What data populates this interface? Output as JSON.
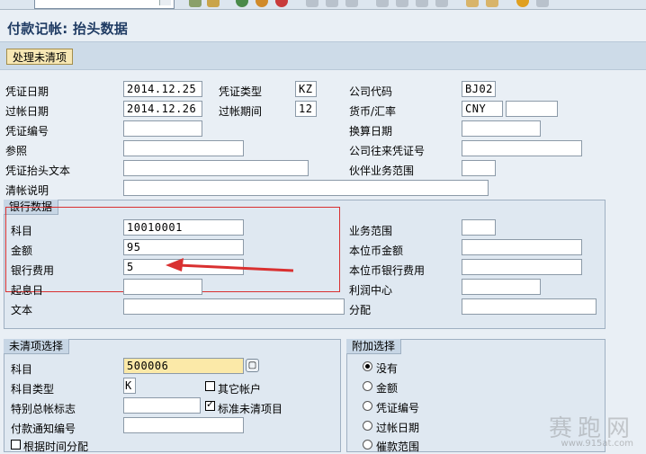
{
  "title": "付款记帐: 抬头数据",
  "app_toolbar": {
    "process_open_items": "处理未清项"
  },
  "header": {
    "doc_date_label": "凭证日期",
    "doc_date": "2014.12.25",
    "doc_type_label": "凭证类型",
    "doc_type": "KZ",
    "company_code_label": "公司代码",
    "company_code": "BJ02",
    "posting_date_label": "过帐日期",
    "posting_date": "2014.12.26",
    "period_label": "过帐期间",
    "period": "12",
    "currency_label": "货币/汇率",
    "currency": "CNY",
    "rate": "",
    "doc_no_label": "凭证编号",
    "doc_no": "",
    "translation_date_label": "换算日期",
    "translation_date": "",
    "reference_label": "参照",
    "reference": "",
    "intercompany_label": "公司往来凭证号",
    "intercompany": "",
    "header_text_label": "凭证抬头文本",
    "header_text": "",
    "trading_partner_label": "伙伴业务范围",
    "trading_partner": "",
    "clearing_text_label": "清帐说明",
    "clearing_text": ""
  },
  "bank_data": {
    "group_title": "银行数据",
    "account_label": "科目",
    "account": "10010001",
    "amount_label": "金额",
    "amount": "95",
    "bank_charges_label": "银行费用",
    "bank_charges": "5",
    "value_date_label": "起息日",
    "value_date": "",
    "text_label": "文本",
    "text": "",
    "business_area_label": "业务范围",
    "business_area": "",
    "lc_amount_label": "本位币金额",
    "lc_amount": "",
    "lc_bank_charges_label": "本位币银行费用",
    "lc_bank_charges": "",
    "profit_center_label": "利润中心",
    "profit_center": "",
    "assignment_label": "分配",
    "assignment": ""
  },
  "open_item_selection": {
    "group_title": "未清项选择",
    "account_label": "科目",
    "account": "500006",
    "account_type_label": "科目类型",
    "account_type": "K",
    "other_accounts_label": "其它帐户",
    "special_gl_label": "特别总帐标志",
    "special_gl": "",
    "standard_oi_label": "标准未清项目",
    "pmt_advice_label": "付款通知编号",
    "pmt_advice": "",
    "distribute_by_age_label": "根据时间分配"
  },
  "additional_selections": {
    "group_title": "附加选择",
    "options": [
      "没有",
      "金额",
      "凭证编号",
      "过帐日期",
      "催款范围"
    ],
    "selected": "没有"
  },
  "watermark": {
    "main": "赛跑网",
    "sub": "www.915at.com"
  },
  "colors": {
    "accent": "#1f3b63",
    "annotation": "#d93030"
  }
}
